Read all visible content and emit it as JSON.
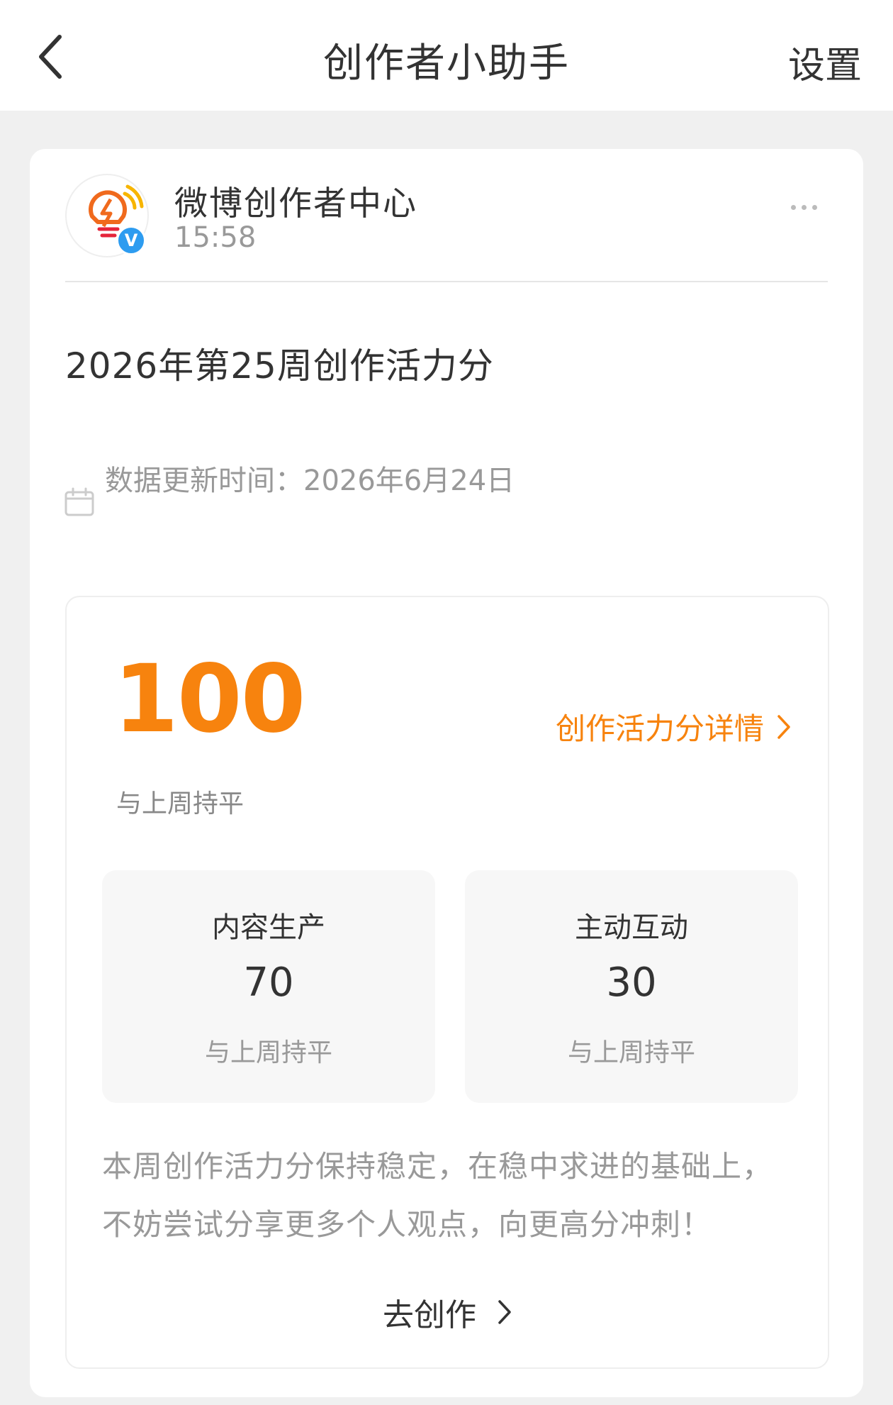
{
  "nav": {
    "title": "创作者小助手",
    "settings_label": "设置",
    "back_icon": "chevron-left-icon"
  },
  "post": {
    "author": "微博创作者中心",
    "time": "15:58",
    "avatar_icon": "lightbulb-logo-icon",
    "verified_mark": "V",
    "title": "2026年第25周创作活力分",
    "update_text": "数据更新时间：2026年6月24日"
  },
  "score": {
    "total": "100",
    "change": "与上周持平",
    "detail_link": "创作活力分详情",
    "accent_color": "#f7830e"
  },
  "breakdown": [
    {
      "label": "内容生产",
      "value": "70",
      "change": "与上周持平"
    },
    {
      "label": "主动互动",
      "value": "30",
      "change": "与上周持平"
    }
  ],
  "summary": "本周创作活力分保持稳定，在稳中求进的基础上，不妨尝试分享更多个人观点，向更高分冲刺！",
  "cta": {
    "label": "去创作"
  }
}
